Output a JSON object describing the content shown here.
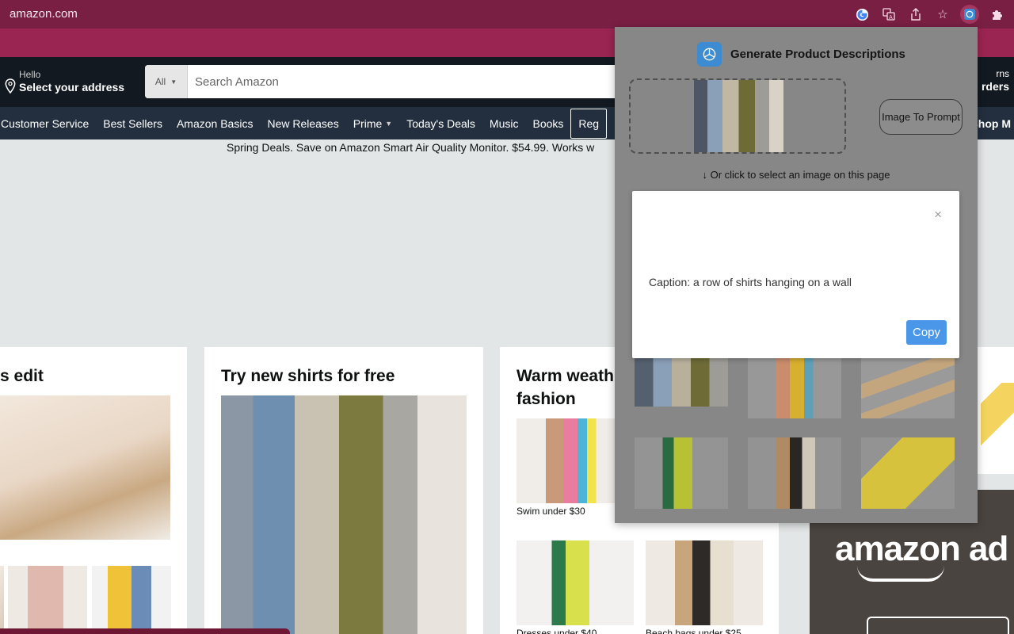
{
  "browser": {
    "url": "amazon.com",
    "icons": [
      "google-icon",
      "translate-icon",
      "share-icon",
      "star-icon",
      "extension-active-icon",
      "puzzle-icon"
    ]
  },
  "header": {
    "address_hello": "Hello",
    "address_select": "Select your address",
    "search_scope": "All",
    "search_placeholder": "Search Amazon",
    "returns_line1": "rns",
    "returns_line2": "rders"
  },
  "nav": {
    "items": [
      "Customer Service",
      "Best Sellers",
      "Amazon Basics",
      "New Releases",
      "Prime",
      "Today's Deals",
      "Music",
      "Books",
      "Reg"
    ],
    "right_item": "Shop M"
  },
  "promo": "Spring Deals. Save on Amazon Smart Air Quality Monitor. $54.99. Works w",
  "cards": {
    "card1": {
      "title": "s edit"
    },
    "card2": {
      "title": "Try new shirts for free"
    },
    "card3": {
      "title_line1": "Warm weath",
      "title_line2": "fashion",
      "items": [
        "Swim under $30",
        "",
        "Dresses under $40",
        "Beach bags under $25"
      ]
    }
  },
  "ads": {
    "word": "amazon ad"
  },
  "popup": {
    "title": "Generate Product Descriptions",
    "image_to_prompt": "Image To Prompt",
    "hint": "↓  Or click to select an image on this page",
    "caption": "Caption: a row of shirts hanging on a wall",
    "close_glyph": "×",
    "copy_label": "Copy"
  },
  "colors": {
    "chrome": "#7a1f44",
    "strip": "#9b2552",
    "amazon_nav": "#131921",
    "amazon_subnav": "#232f3e",
    "copy_button": "#4a97ea",
    "popup_bg": "#878787"
  }
}
